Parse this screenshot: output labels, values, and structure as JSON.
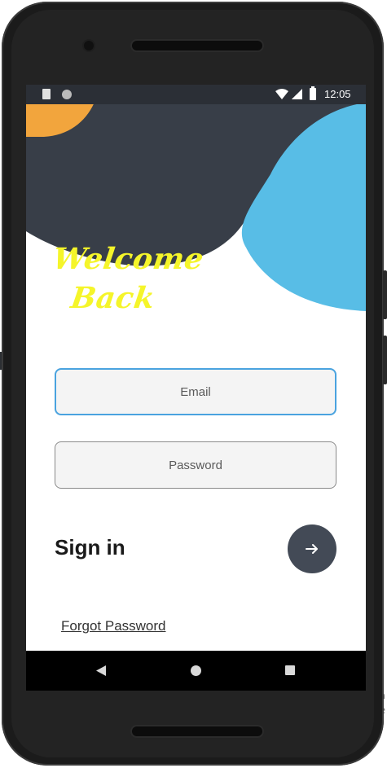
{
  "status_bar": {
    "time": "12:05",
    "icons": [
      "sd-card-icon",
      "circle-icon",
      "wifi-icon",
      "signal-icon",
      "battery-icon"
    ]
  },
  "colors": {
    "dark_blob": "#383e48",
    "blue_blob": "#58bde6",
    "orange_blob": "#f2a53d",
    "welcome_text": "#f5f52a",
    "button": "#434a56",
    "email_border": "#4aa3df"
  },
  "welcome": {
    "line1": "Welcome",
    "line2": "Back"
  },
  "form": {
    "email_placeholder": "Email",
    "password_placeholder": "Password"
  },
  "signin": {
    "label": "Sign in",
    "submit_icon": "arrow-right-icon"
  },
  "forgot_password": "Forgot Password",
  "nav_bar": {
    "icons": [
      "back-icon",
      "home-icon",
      "recents-icon"
    ]
  }
}
